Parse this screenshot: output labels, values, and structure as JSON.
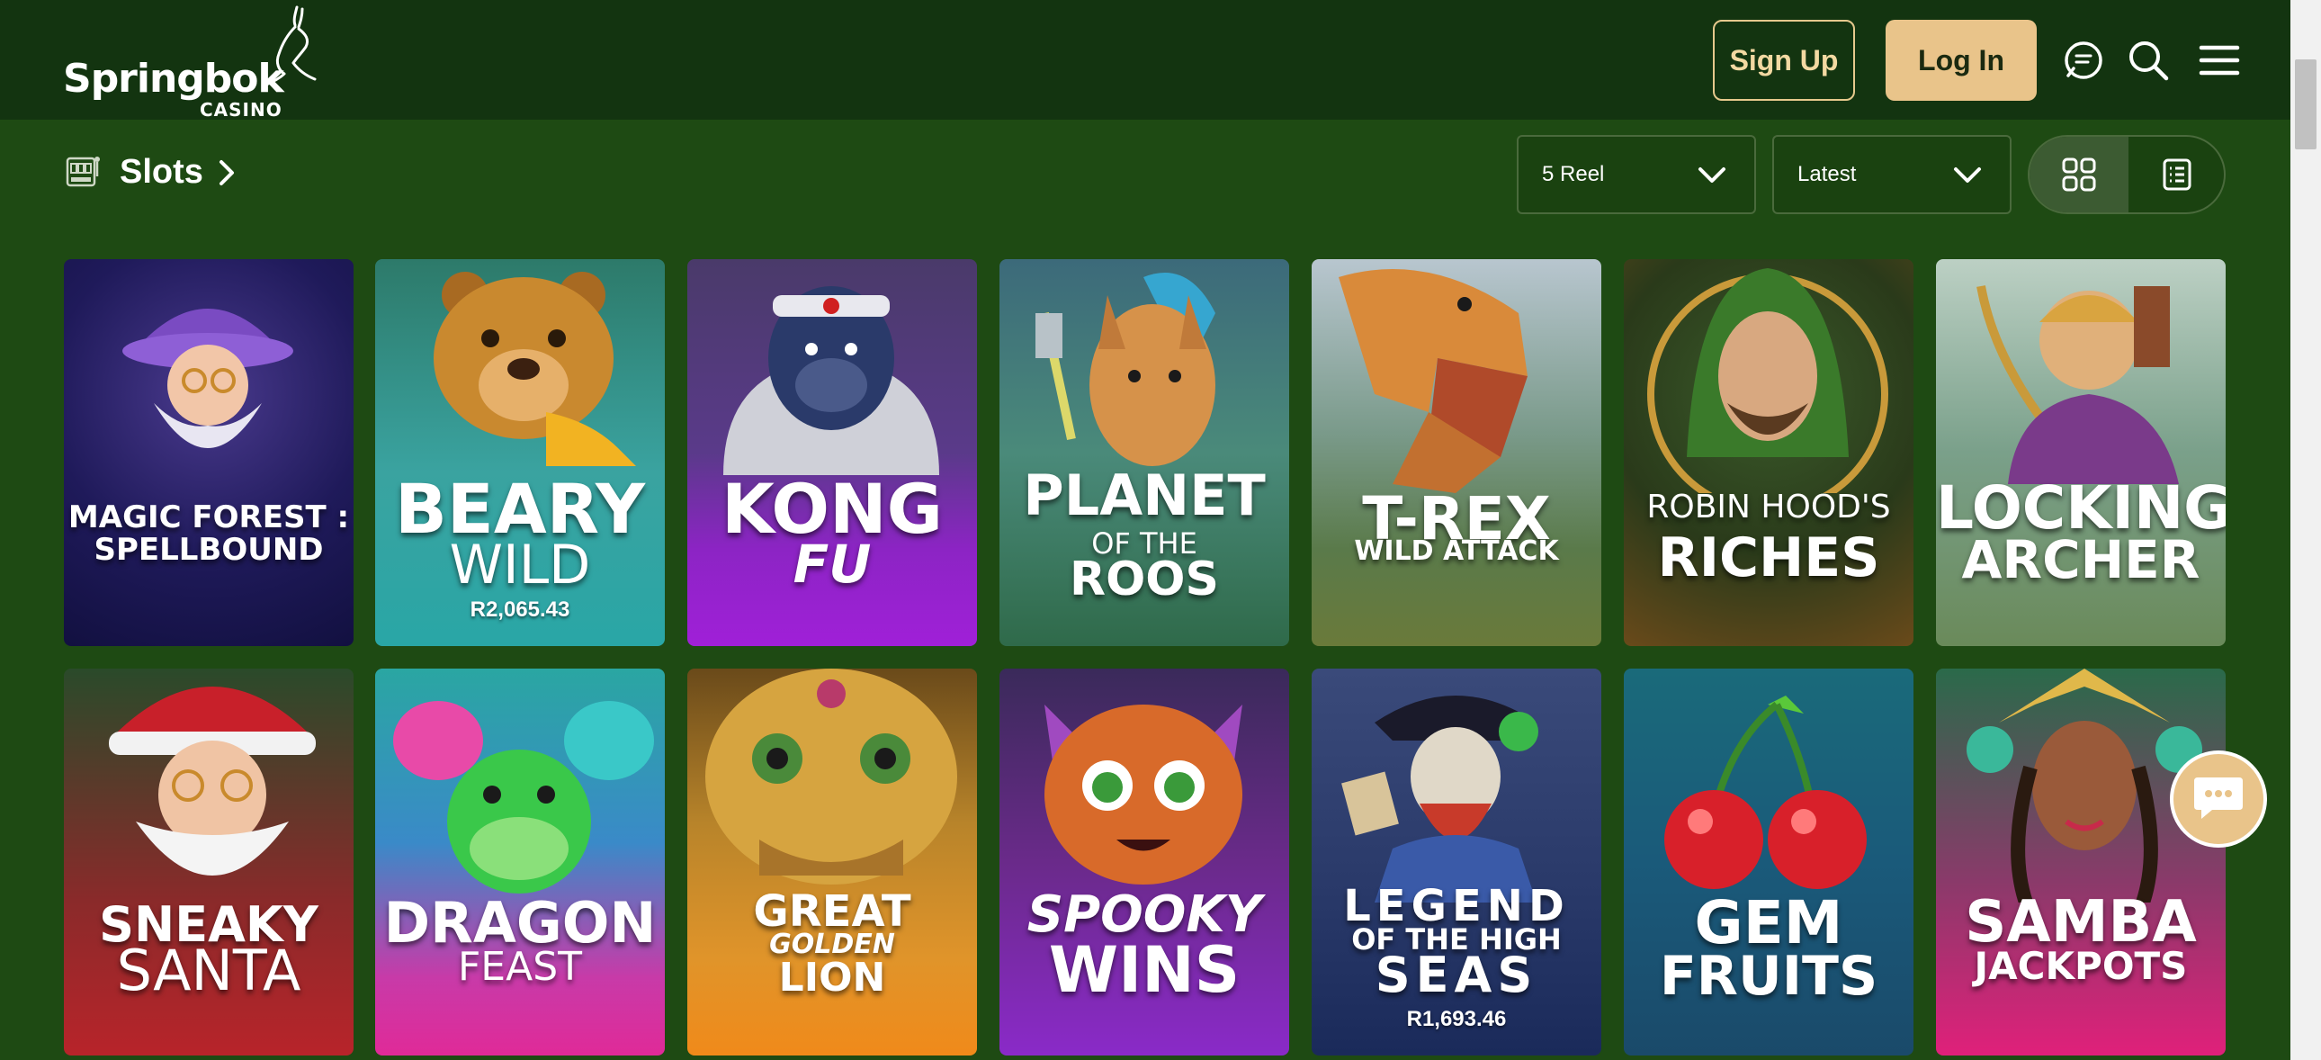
{
  "header": {
    "logo_text": "Springbok",
    "logo_subtext": "CASINO",
    "signup_label": "Sign Up",
    "login_label": "Log In",
    "chat_icon": "chat-bubble-icon",
    "search_icon": "search-icon",
    "menu_icon": "hamburger-menu-icon"
  },
  "filters": {
    "section_title": "Slots",
    "reel_select": "5 Reel",
    "sort_select": "Latest"
  },
  "games": [
    {
      "line1": "MAGIC FOREST :",
      "line2": "SPELLBOUND",
      "jackpot": ""
    },
    {
      "line1": "BEARY",
      "line2": "WILD",
      "jackpot": "R2,065.43"
    },
    {
      "line1": "KONG",
      "line2": "FU",
      "jackpot": ""
    },
    {
      "line1": "PLANET",
      "line2": "OF THE",
      "line3": "ROOS",
      "jackpot": ""
    },
    {
      "line1": "T-REX",
      "line2": "WILD ATTACK",
      "jackpot": ""
    },
    {
      "line1": "ROBIN HOOD'S",
      "line2": "RICHES",
      "jackpot": ""
    },
    {
      "line1": "LOCKING",
      "line2": "ARCHER",
      "jackpot": ""
    },
    {
      "line1": "SNEAKY",
      "line2": "SANTA",
      "jackpot": ""
    },
    {
      "line1": "DRAGON",
      "line2": "FEAST",
      "jackpot": ""
    },
    {
      "line1": "GREAT",
      "line2": "GOLDEN",
      "line3": "LION",
      "jackpot": ""
    },
    {
      "line1": "SPOOKY",
      "line2": "WINS",
      "jackpot": ""
    },
    {
      "line1": "LEGEND",
      "line2": "OF THE HIGH",
      "line3": "SEAS",
      "jackpot": "R1,693.46"
    },
    {
      "line1": "GEM",
      "line2": "FRUITS",
      "jackpot": ""
    },
    {
      "line1": "SAMBA",
      "line2": "JACKPOTS",
      "jackpot": ""
    }
  ],
  "colors": {
    "background": "#1e4a13",
    "header": "#133410",
    "accent": "#e9c48a"
  }
}
